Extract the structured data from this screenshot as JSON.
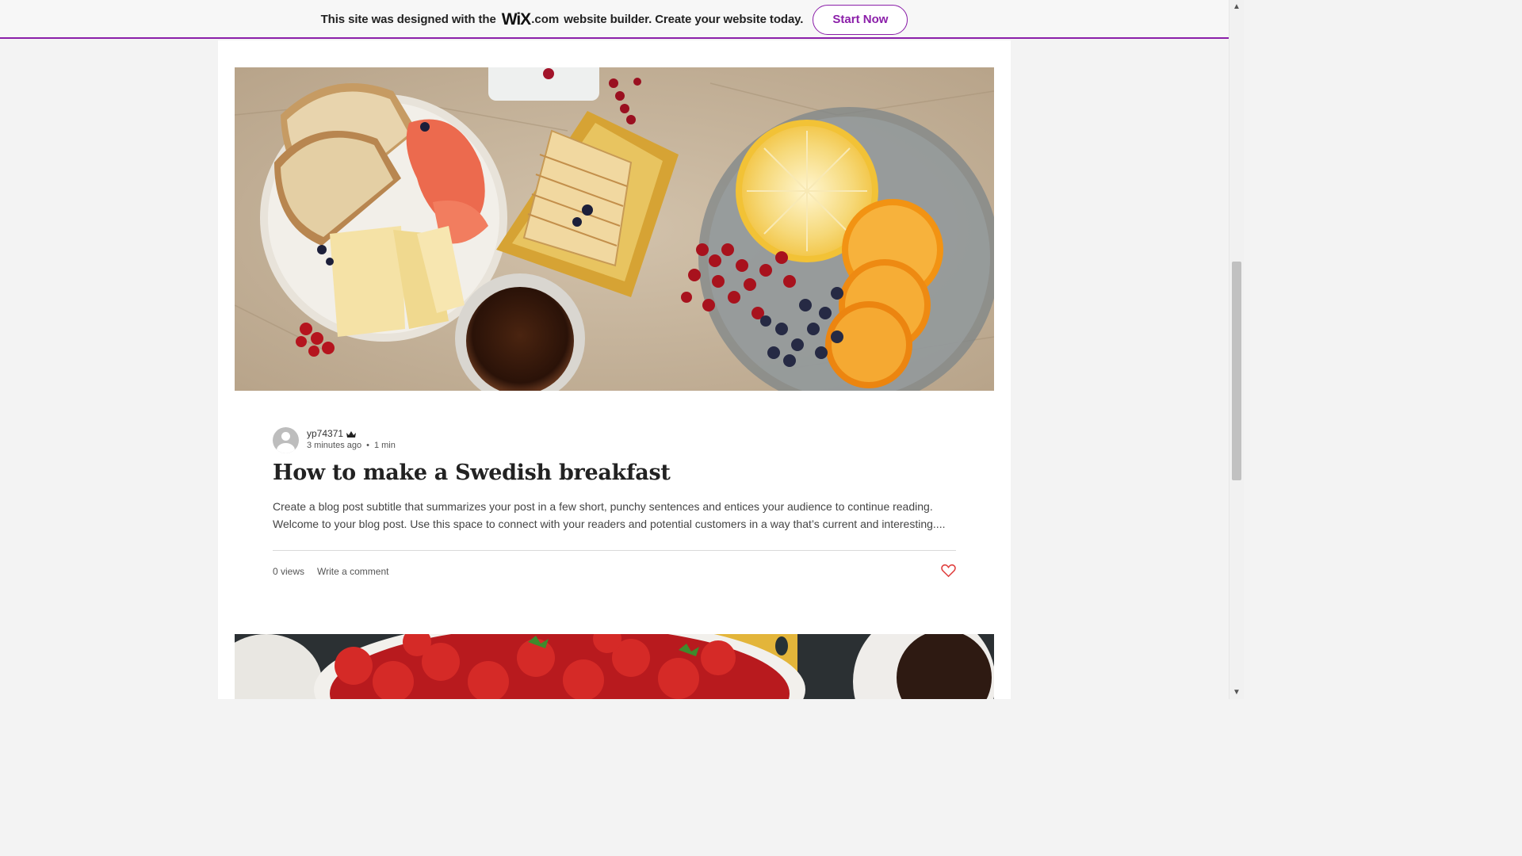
{
  "banner": {
    "text_before": "This site was designed with the",
    "logo": "WiX",
    "logo_suffix": ".com",
    "text_after": "website builder. Create your website today.",
    "button_label": "Start Now",
    "accent_color": "#8b1fa9"
  },
  "post": {
    "author": "yp74371",
    "author_icon": "crown-icon",
    "time_ago": "3 minutes ago",
    "separator": "•",
    "read_time": "1 min",
    "title": "How to make a Swedish breakfast",
    "excerpt_line1": "Create a blog post subtitle that summarizes your post in a few short, punchy sentences and entices your audience to continue reading.",
    "excerpt_line2": "Welcome to your blog post. Use this space to connect with your readers and potential customers in a way that’s current and interesting....",
    "views": "0 views",
    "comment_label": "Write a comment",
    "like_icon": "heart-icon",
    "like_color": "#e0403f"
  },
  "scrollbar": {
    "up_icon": "▲",
    "down_icon": "▼"
  }
}
